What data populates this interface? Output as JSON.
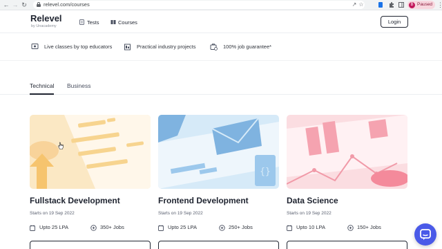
{
  "browser": {
    "back_icon": "arrow-left-icon",
    "forward_icon": "arrow-right-icon",
    "reload_icon": "reload-icon",
    "url": "relevel.com/courses",
    "profile_initial": "B",
    "profile_status": "Paused"
  },
  "header": {
    "logo": "Relevel",
    "logo_sub": "by Unacademy",
    "nav": [
      {
        "label": "Tests",
        "icon": "document-icon"
      },
      {
        "label": "Courses",
        "icon": "book-icon"
      }
    ],
    "login_label": "Login"
  },
  "features": [
    {
      "label": "Live classes by top educators",
      "icon": "live-class-icon"
    },
    {
      "label": "Practical industry projects",
      "icon": "project-icon"
    },
    {
      "label": "100% job guarantee*",
      "icon": "job-guarantee-icon"
    }
  ],
  "tabs": [
    {
      "label": "Technical",
      "active": true
    },
    {
      "label": "Business",
      "active": false
    }
  ],
  "courses": [
    {
      "title": "Fullstack Development",
      "starts": "Starts on 19 Sep 2022",
      "salary": "Upto 25 LPA",
      "jobs": "350+ Jobs",
      "theme": "#fbe8c4"
    },
    {
      "title": "Frontend Development",
      "starts": "Starts on 19 Sep 2022",
      "salary": "Upto 25 LPA",
      "jobs": "250+ Jobs",
      "theme": "#d6eaf8"
    },
    {
      "title": "Data Science",
      "starts": "Starts on 19 Sep 2022",
      "salary": "Upto 10 LPA",
      "jobs": "150+ Jobs",
      "theme": "#fbdde1"
    }
  ],
  "colors": {
    "chat_accent": "#4a5ae8",
    "text_primary": "#1f2430"
  }
}
